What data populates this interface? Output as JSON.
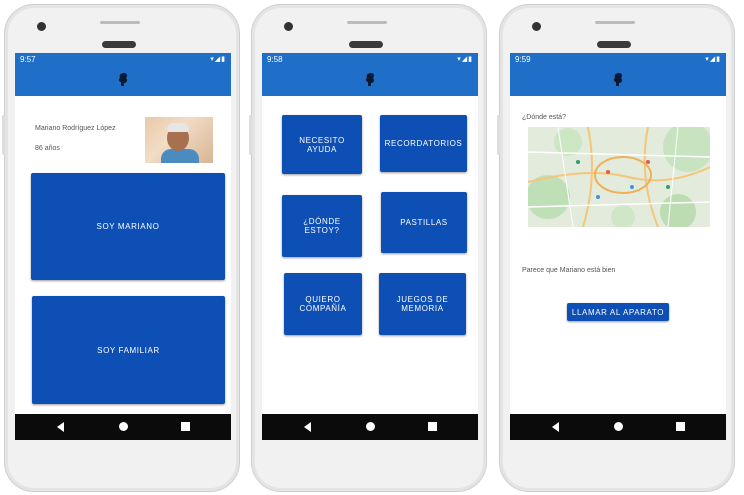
{
  "screens": [
    {
      "time": "9:57",
      "profile": {
        "name": "Mariano Rodríguez López",
        "age": "86 años"
      },
      "buttons": {
        "self": "SOY MARIANO",
        "family": "SOY FAMILIAR"
      }
    },
    {
      "time": "9:58",
      "buttons": [
        "NECESITO\nAYUDA",
        "RECORDATORIOS",
        "¿DÓNDE\nESTOY?",
        "PASTILLAS",
        "QUIERO\nCOMPAÑÍA",
        "JUEGOS DE\nMEMORIA"
      ]
    },
    {
      "time": "9:59",
      "question": "¿Dónde está?",
      "status_message": "Parece que Mariano está bien",
      "call_button": "LLAMAR AL APARATO"
    }
  ],
  "colors": {
    "statusbar": "#1f6fc9",
    "button": "#0d4fb5",
    "navbar": "#0b0b0b"
  },
  "icons": [
    "app-logo-icon",
    "back-icon",
    "home-icon",
    "recents-icon",
    "wifi-icon",
    "signal-icon",
    "battery-icon"
  ]
}
